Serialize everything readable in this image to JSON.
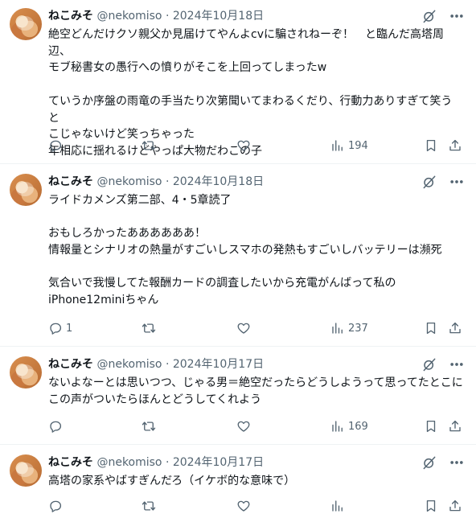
{
  "tweets": [
    {
      "name": "ねこみそ",
      "handle": "@nekomiso",
      "sep": "·",
      "date": "2024年10月18日",
      "lines": [
        "絶空どんだけクソ親父か見届けてやんよcvに騙されねーぞ！　と臨んだ高塔周辺、",
        "モブ秘書女の愚行への憤りがそこを上回ってしまったw",
        "",
        "ていうか序盤の雨竜の手当たり次第聞いてまわるくだり、行動力ありすぎて笑うと",
        "こじゃないけど笑っちゃった",
        "年相応に揺れるけどやっぱ大物だわこの子"
      ],
      "replies": "",
      "retweets": "",
      "likes": "",
      "views": "194"
    },
    {
      "name": "ねこみそ",
      "handle": "@nekomiso",
      "sep": "·",
      "date": "2024年10月18日",
      "lines": [
        "ライドカメンズ第二部、4・5章読了",
        "",
        "おもしろかったああああああ！",
        "情報量とシナリオの熱量がすごいしスマホの発熱もすごいしバッテリーは瀕死",
        "",
        "気合いで我慢してた報酬カードの調査したいから充電がんばって私の",
        "iPhone12miniちゃん"
      ],
      "replies": "1",
      "retweets": "",
      "likes": "",
      "views": "237"
    },
    {
      "name": "ねこみそ",
      "handle": "@nekomiso",
      "sep": "·",
      "date": "2024年10月17日",
      "lines": [
        "ないよなーとは思いつつ、じゃる男＝絶空だったらどうしようって思ってたとこに",
        "この声がついたらほんとどうしてくれよう"
      ],
      "replies": "",
      "retweets": "",
      "likes": "",
      "views": "169"
    },
    {
      "name": "ねこみそ",
      "handle": "@nekomiso",
      "sep": "·",
      "date": "2024年10月17日",
      "lines": [
        "高塔の家系やばすぎんだろ（イケボ的な意味で）"
      ],
      "replies": "",
      "retweets": "",
      "likes": "",
      "views": ""
    }
  ]
}
